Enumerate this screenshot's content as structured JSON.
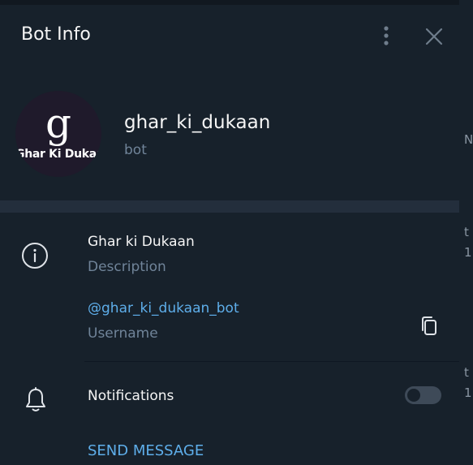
{
  "panel": {
    "title": "Bot Info"
  },
  "bot": {
    "name": "ghar_ki_dukaan",
    "status": "bot",
    "avatar_glyph": "g",
    "avatar_text": "Ghar Ki Dukaan"
  },
  "info": {
    "description_value": "Ghar ki Dukaan",
    "description_label": "Description",
    "username_value": "@ghar_ki_dukaan_bot",
    "username_label": "Username"
  },
  "notifications": {
    "label": "Notifications",
    "enabled": false
  },
  "actions": {
    "send_message": "SEND MESSAGE"
  },
  "background_chat": {
    "letters": [
      "N",
      "t",
      "1",
      "t",
      "1"
    ]
  },
  "icons": {
    "more": "more-vertical-icon",
    "close": "close-icon",
    "info": "info-icon",
    "copy": "copy-icon",
    "bell": "bell-icon"
  },
  "colors": {
    "panel_bg": "#17212b",
    "accent": "#5eaeea",
    "text_primary": "#f5f5f5",
    "text_secondary": "#708499"
  }
}
